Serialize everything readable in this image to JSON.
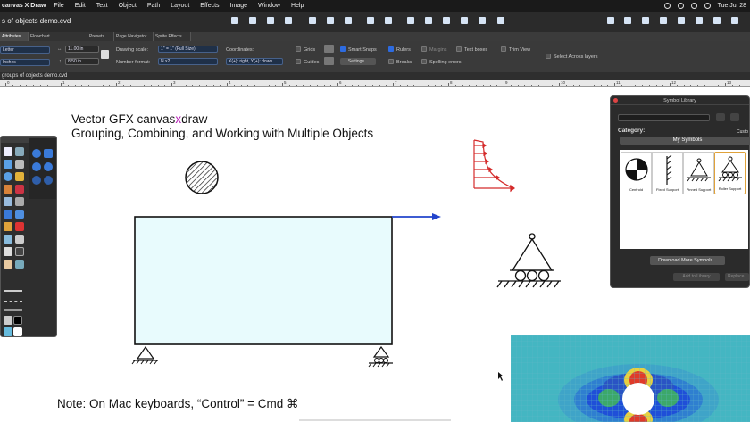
{
  "menubar": {
    "app_name": "canvas X Draw",
    "items": [
      "File",
      "Edit",
      "Text",
      "Object",
      "Path",
      "Layout",
      "Effects",
      "Image",
      "Window",
      "Help"
    ],
    "clock": "Tue Jul 28"
  },
  "window": {
    "title": "s of objects demo.cvd"
  },
  "panel_tabs": [
    "Attributes",
    "Flowchart",
    "Presets",
    "Page Navigator",
    "Sprite Effects"
  ],
  "controls": {
    "paper_size": "Letter",
    "units": "Inches",
    "width": "11.00 in",
    "height": "8.50 in",
    "drawing_scale_label": "Drawing scale:",
    "drawing_scale_value": "1\" = 1\"   (Full Size)",
    "number_format_label": "Number format:",
    "number_format_value": "N.x2",
    "coordinates_label": "Coordinates:",
    "coordinates_value": "X(+): right, Y(+): down",
    "grids_label": "Grids",
    "guides_label": "Guides",
    "smart_snaps_label": "Smart Snaps",
    "settings_button": "Settings...",
    "rulers_label": "Rulers",
    "breaks_label": "Breaks",
    "margins_label": "Margins",
    "spelling_label": "Spelling errors",
    "text_boxes_label": "Text boxes",
    "trim_view_label": "Trim View",
    "select_across_label": "Select Across layers"
  },
  "doc_tab": {
    "label": "groups of objects demo.cvd"
  },
  "ruler": {
    "labels": [
      "0",
      "1",
      "2",
      "3",
      "4",
      "5",
      "6",
      "7",
      "8",
      "9",
      "10",
      "11",
      "12",
      "13",
      "14"
    ]
  },
  "canvas": {
    "title_prefix": "Vector GFX canvas",
    "title_x": "x",
    "title_suffix": "draw —",
    "subtitle": "Grouping, Combining, and Working with Multiple Objects",
    "note": "Note: On Mac keyboards, “Control” = Cmd ⌘"
  },
  "symbol_library": {
    "title": "Symbol Library",
    "category_label": "Category:",
    "custom_label": "Custo",
    "category_value": "My Symbols",
    "symbols": [
      "Centroid",
      "Fixed Support",
      "Pinned Support",
      "Roller Support"
    ],
    "download_button": "Download More Symbols...",
    "add_button": "Add to Library",
    "replace_button": "Replace"
  },
  "colors": {
    "accent_blue": "#2d6be0",
    "arrow_red": "#d42a2a",
    "arrow_blue": "#2244cc",
    "rect_fill": "#e8fbfd"
  }
}
